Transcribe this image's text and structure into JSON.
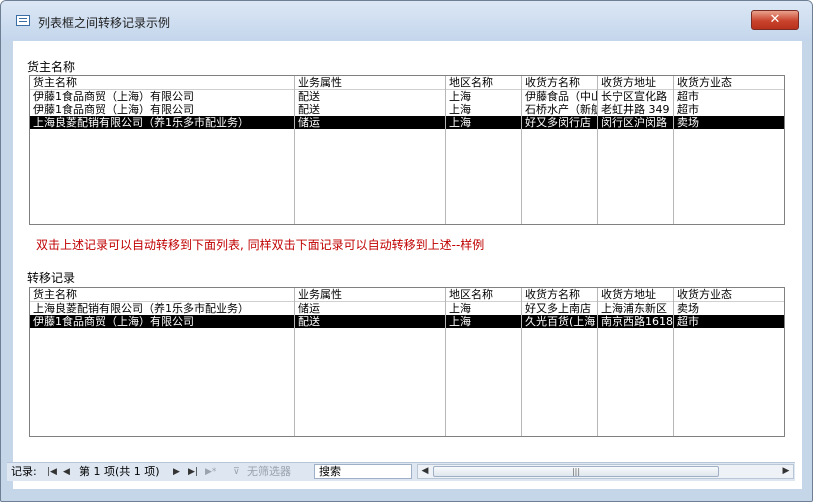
{
  "window": {
    "title": "列表框之间转移记录示例",
    "close_glyph": "✕"
  },
  "source": {
    "section_label": "货主名称",
    "columns": [
      "货主名称",
      "业务属性",
      "地区名称",
      "收货方名称",
      "收货方地址",
      "收货方业态"
    ],
    "rows": [
      [
        "伊藤1食品商贸（上海）有限公司",
        "配送",
        "上海",
        "伊藤食品（中山",
        "长宁区宣化路",
        "超市"
      ],
      [
        "伊藤1食品商贸（上海）有限公司",
        "配送",
        "上海",
        "石桥水产（新航",
        "老虹井路 349",
        "超市"
      ],
      [
        "上海良菱配销有限公司（养1乐多市配业务）",
        "储运",
        "上海",
        "好又多闵行店",
        "闵行区沪闵路",
        "卖场"
      ]
    ],
    "selected_index": 2
  },
  "hint_text": "双击上述记录可以自动转移到下面列表, 同样双击下面记录可以自动转移到上述--样例",
  "transfer": {
    "section_label": "转移记录",
    "columns": [
      "货主名称",
      "业务属性",
      "地区名称",
      "收货方名称",
      "收货方地址",
      "收货方业态"
    ],
    "rows": [
      [
        "上海良菱配销有限公司（养1乐多市配业务）",
        "储运",
        "上海",
        "好又多上南店",
        "上海浦东新区",
        "卖场"
      ],
      [
        "伊藤1食品商贸（上海）有限公司",
        "配送",
        "上海",
        "久光百货(上海",
        "南京西路1618",
        "超市"
      ]
    ],
    "selected_index": 1
  },
  "statusbar": {
    "record_label": "记录:",
    "first_glyph": "|◀",
    "prev_glyph": "◀",
    "position_text": "第 1 项(共 1 项)",
    "next_glyph": "▶",
    "last_glyph": "▶|",
    "new_glyph": "▶*",
    "filter_label": "无筛选器",
    "filter_glyph": "⊽",
    "search_placeholder": "搜索",
    "scroll_left_glyph": "◀",
    "scroll_right_glyph": "▶",
    "thumb_grip": "|||"
  }
}
